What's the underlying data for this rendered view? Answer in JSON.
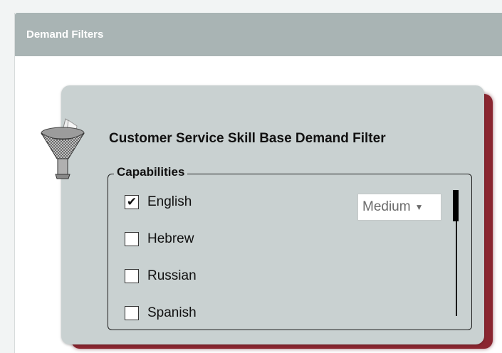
{
  "panel": {
    "title": "Demand Filters"
  },
  "card": {
    "title": "Customer Service Skill Base Demand Filter"
  },
  "group": {
    "legend": "Capabilities"
  },
  "capabilities": [
    {
      "label": "English",
      "checked": true
    },
    {
      "label": "Hebrew",
      "checked": false
    },
    {
      "label": "Russian",
      "checked": false
    },
    {
      "label": "Spanish",
      "checked": false
    }
  ],
  "level_select": {
    "value": "Medium"
  },
  "icons": {
    "filter": "funnel-filter-icon",
    "dropdown": "caret-down-icon",
    "check": "checkmark-icon"
  },
  "colors": {
    "header_bg": "#a9b4b4",
    "card_bg": "#c9d1d1",
    "card_shadow": "#8a2630"
  }
}
